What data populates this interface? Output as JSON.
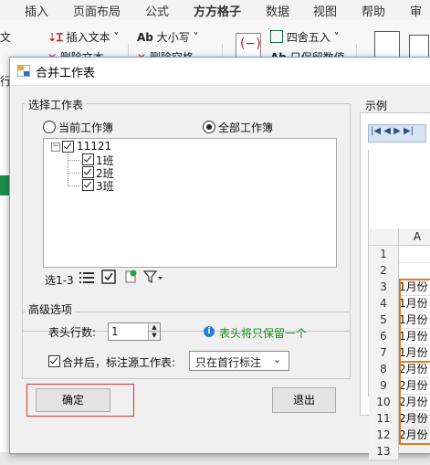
{
  "ribbon": {
    "tabs": [
      "插入",
      "页面布局",
      "公式",
      "方方格子",
      "数据",
      "视图",
      "帮助",
      "审阅"
    ],
    "active_tab": "方方格子",
    "items": {
      "insert_text": "插入文本",
      "delete_text": "删除文本",
      "case": "大小写",
      "delete_space": "删除空格",
      "round": "四舍五入",
      "keep_value": "只保留数值",
      "left_wen": "文",
      "left_xing": "行"
    }
  },
  "dialog": {
    "title": "合并工作表",
    "select_group": {
      "label": "选择工作表",
      "radio_current": "当前工作簿",
      "radio_all": "全部工作簿",
      "selected": "全部工作簿"
    },
    "tree": {
      "root": "11121",
      "children": [
        "1班",
        "2班",
        "3班"
      ]
    },
    "tree_toolbar": {
      "range_label": "选1-3"
    },
    "advanced": {
      "label": "高级选项",
      "header_rows_label": "表头行数:",
      "header_rows_value": "1",
      "info_text": "表头将只保留一个",
      "mark_source_label": "合并后，标注源工作表:",
      "mark_source_checked": true,
      "mark_source_option": "只在首行标注"
    },
    "buttons": {
      "ok": "确定",
      "exit": "退出"
    },
    "preview": {
      "label": "示例",
      "column_header": "A",
      "rows": [
        {
          "num": "1",
          "value": ""
        },
        {
          "num": "2",
          "value": ""
        },
        {
          "num": "3",
          "value": "1月份"
        },
        {
          "num": "4",
          "value": "1月份"
        },
        {
          "num": "5",
          "value": "1月份"
        },
        {
          "num": "6",
          "value": "1月份"
        },
        {
          "num": "7",
          "value": "1月份"
        },
        {
          "num": "8",
          "value": "2月份"
        },
        {
          "num": "9",
          "value": "2月份"
        },
        {
          "num": "10",
          "value": "2月份"
        },
        {
          "num": "11",
          "value": "2月份"
        },
        {
          "num": "12",
          "value": "2月份"
        },
        {
          "num": "13",
          "value": ""
        }
      ]
    }
  },
  "colors": {
    "excel_green": "#1e7145",
    "highlight_orange": "#e07a1f",
    "focus_red": "#e03030",
    "info_green": "#1a8a1a"
  }
}
